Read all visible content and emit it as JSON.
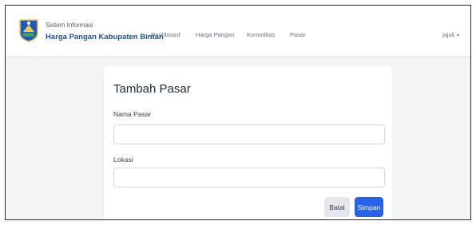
{
  "app": {
    "name_small": "Sistem Informasi",
    "name_large": "Harga Pangan Kabupaten Bintan"
  },
  "nav": {
    "items": [
      {
        "label": "Dashboard"
      },
      {
        "label": "Harga Pangan"
      },
      {
        "label": "Komoditas"
      },
      {
        "label": "Pasar"
      }
    ],
    "user": "jajuli"
  },
  "form": {
    "title": "Tambah Pasar",
    "fields": [
      {
        "label": "Nama Pasar",
        "value": "",
        "placeholder": ""
      },
      {
        "label": "Lokasi",
        "value": "",
        "placeholder": ""
      }
    ],
    "cancel_label": "Batal",
    "save_label": "Simpan"
  },
  "colors": {
    "brand": "#1f4e8f",
    "primary_button": "#2563eb",
    "secondary_button": "#e5e7eb",
    "page_background": "#f3f4f6"
  },
  "icons": {
    "logo": "regency-crest-logo",
    "user_menu": "chevron-down-icon"
  }
}
